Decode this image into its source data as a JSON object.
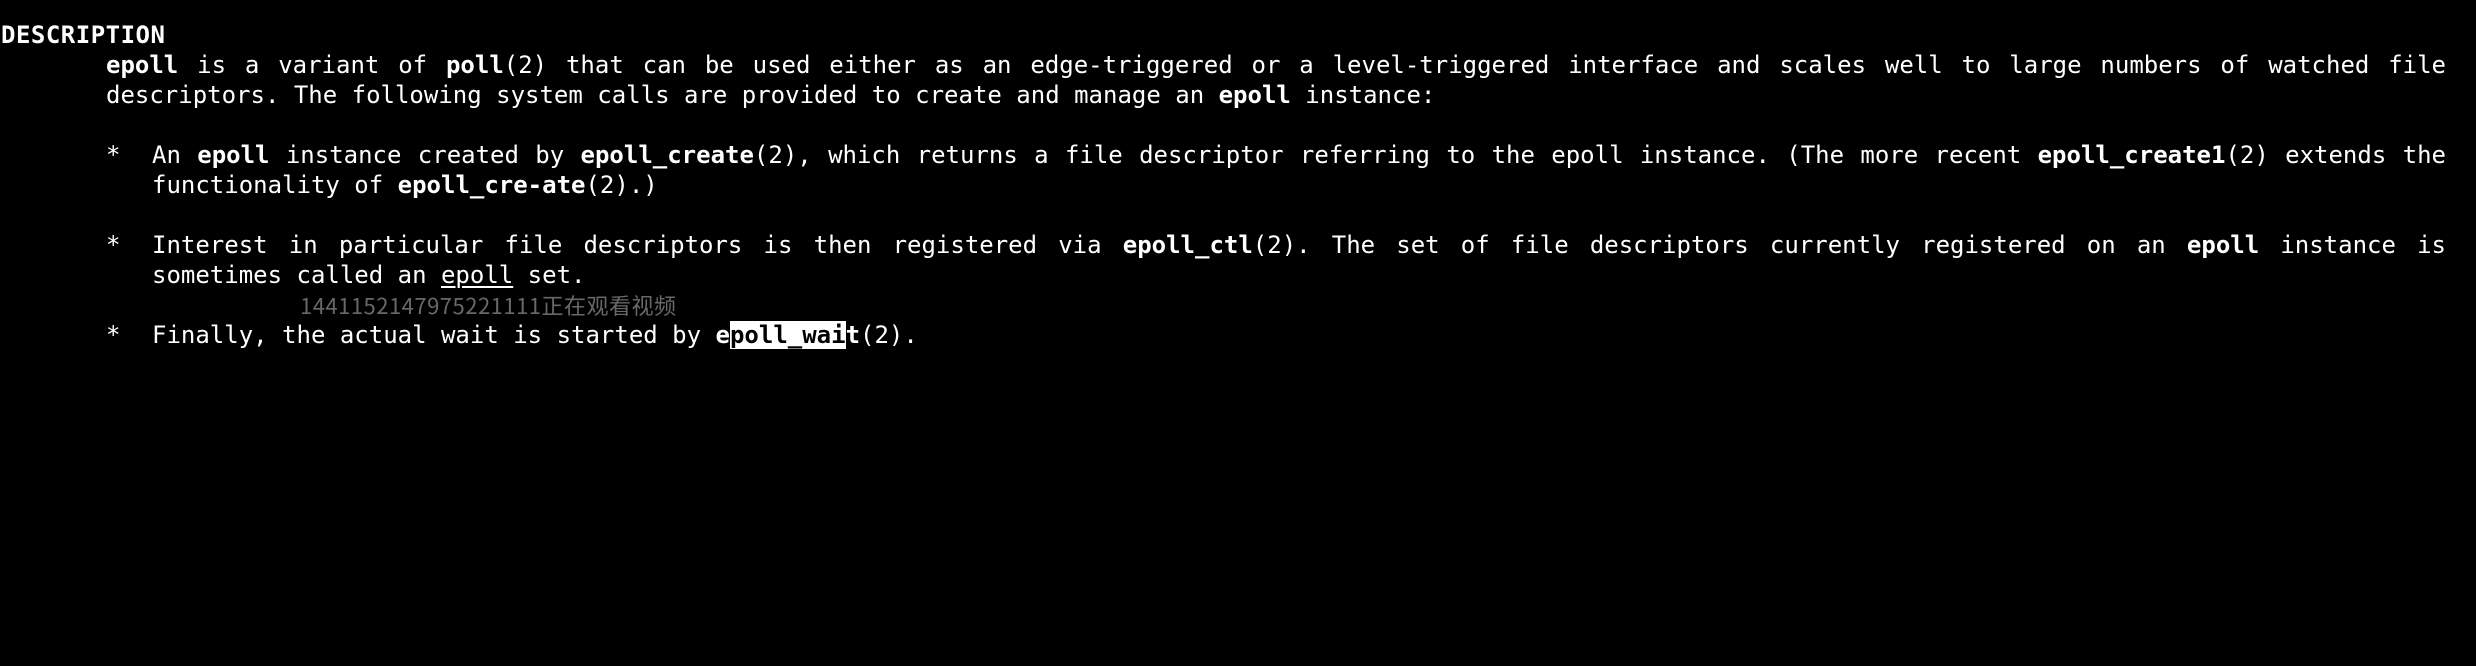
{
  "section_header": "DESCRIPTION",
  "intro": {
    "p1_a": "epoll",
    "p1_b": "  is  a variant of ",
    "p1_c": "poll",
    "p1_d": "(2) that can be used either as an edge-triggered or a level-triggered interface and scales well to large numbers of watched file  descriptors.   The  following  system calls are provided to create and manage an ",
    "p1_e": "epoll",
    "p1_f": " instance:"
  },
  "bullets": {
    "0": {
      "a": "An ",
      "b": "epoll",
      "c": " instance created by ",
      "d": "epoll_create",
      "e": "(2), which returns a file descriptor referring to the epoll instance.  (The more recent ",
      "f": "epoll_create1",
      "g": "(2) extends  the  functionality  of  ",
      "h": "epoll_cre‐ate",
      "i": "(2).)"
    },
    "1": {
      "a": "Interest  in particular file descriptors is then registered via ",
      "b": "epoll_ctl",
      "c": "(2).  The set of file descriptors currently registered on an ",
      "d": "epoll",
      "e": " instance is sometimes called an ",
      "f": "epoll",
      "g": " set."
    },
    "2": {
      "a": "Finally, the actual wait is started by ",
      "b_pre": "e",
      "b_sel": "poll_wai",
      "b_post": "t",
      "c": "(2)."
    }
  },
  "watermark": "1441152147975221111正在观看视频"
}
